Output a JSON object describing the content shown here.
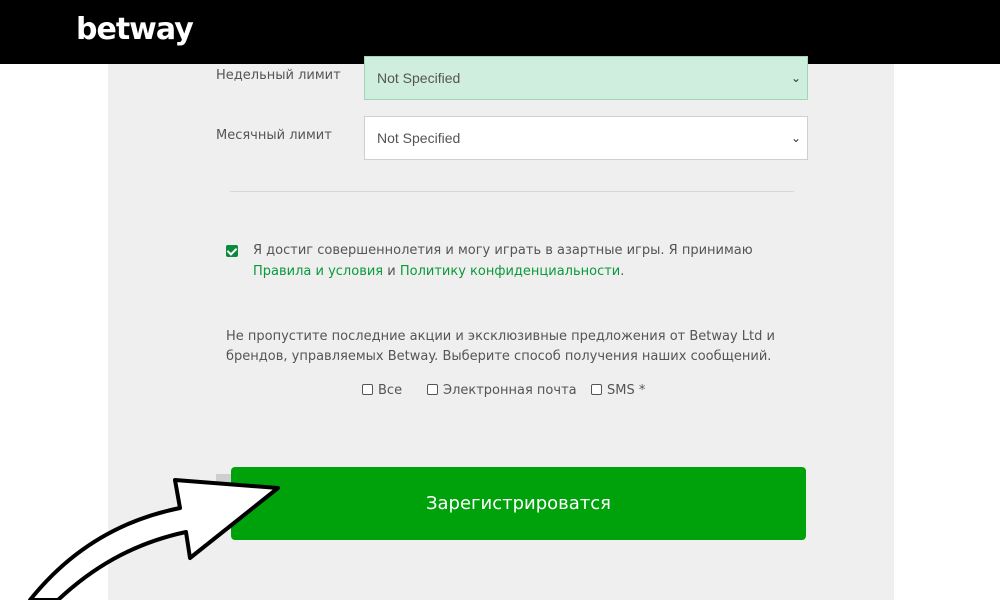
{
  "header": {
    "brand": "betway"
  },
  "form": {
    "weekly": {
      "label": "Недельный лимит",
      "value": "Not Specified"
    },
    "monthly": {
      "label": "Месячный лимит",
      "value": "Not Specified"
    },
    "consent": {
      "text_before": "Я достиг совершеннолетия и могу играть в азартные игры. Я принимаю ",
      "terms_link": "Правила и условия",
      "and": " и ",
      "privacy_link": "Политику конфиденциальности",
      "text_after": "."
    },
    "promo_text": "Не пропустите последние акции и эксклюзивные предложения от Betway Ltd и брендов, управляемых Betway. Выберите способ получения наших сообщений.",
    "channels": {
      "all": "Все",
      "email": "Электронная почта",
      "sms": "SMS *"
    },
    "register_label": "Зарегистрироватся"
  },
  "colors": {
    "accent": "#00a20b",
    "link": "#0a9a3a",
    "header_bg": "#000000"
  }
}
